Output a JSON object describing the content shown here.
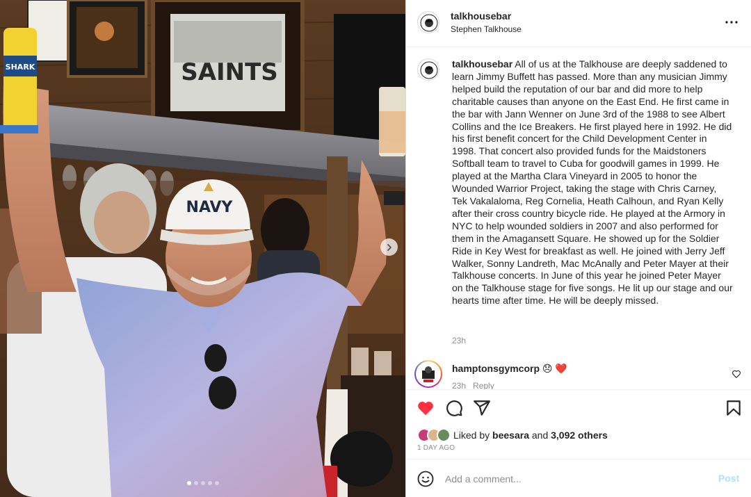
{
  "post": {
    "username": "talkhousebar",
    "location": "Stephen Talkhouse",
    "caption": "All of us at the Talkhouse are deeply saddened to learn Jimmy Buffett has passed.  More than any musician Jimmy helped build the reputation of our bar and did more to help charitable causes than anyone on the East End.  He first came in the bar with Jann Wenner on June 3rd of the 1988 to see Albert Collins and the Ice Breakers.  He first played here in 1992.  He did his first benefit concert for the Child Development Center in 1998.  That concert also provided funds for the Maidstoners Softball team to travel to Cuba for goodwill games in 1999.  He played at the Martha Clara Vineyard in 2005 to honor the Wounded Warrior Project, taking the stage with Chris Carney, Tek Vakalaloma, Reg Cornelia, Heath Calhoun, and Ryan Kelly after their cross country bicycle ride.  He played at the Armory in NYC to help wounded soldiers in 2007 and also performed for them in the Amagansett Square.  He showed up for the  Soldier Ride in Key West for breakfast as well.  He joined with Jerry Jeff Walker, Sonny Landreth, Mac McAnally and Peter Mayer at their Talkhouse concerts.  In June of this year he joined Peter Mayer on the Talkhouse stage for five songs.  He lit up our stage and our hearts time after time.  He will be deeply missed.",
    "caption_time": "23h",
    "avatar_text": "STEPHEN TALKHOUSE"
  },
  "photo": {
    "cap_text": "NAVY",
    "sign_text": "SAINTS",
    "can_text": "SHARK",
    "carousel": {
      "total": 5,
      "active": 1
    }
  },
  "comment": {
    "username": "hamptonsgymcorp",
    "text": "😞 ❤️",
    "time": "23h",
    "reply_label": "Reply"
  },
  "likes": {
    "prefix": "Liked by ",
    "first_liker": "beesara",
    "middle": " and ",
    "others": "3,092 others",
    "date": "1 DAY AGO"
  },
  "add_comment": {
    "placeholder": "Add a comment...",
    "post_label": "Post"
  },
  "colors": {
    "like_red": "#ff3040",
    "post_button_disabled": "#b2dffc",
    "secondary_text": "#8e8e8e"
  }
}
